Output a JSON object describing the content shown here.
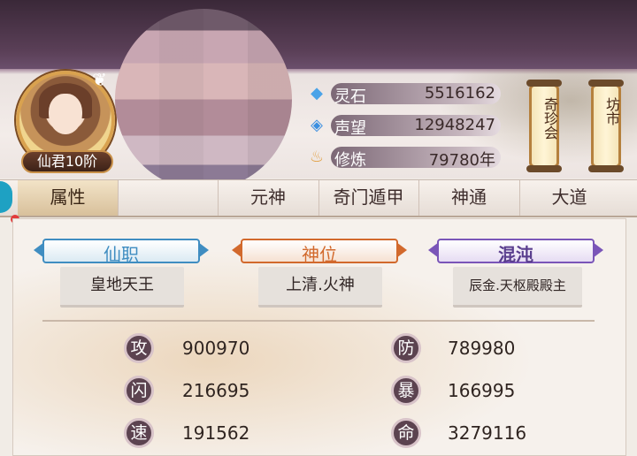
{
  "profile": {
    "rank_label": "仙君10阶"
  },
  "resources": [
    {
      "icon": "spirit-stone-icon",
      "label": "灵石",
      "value": "5516162",
      "icon_color": "#4aa3e8"
    },
    {
      "icon": "reputation-icon",
      "label": "声望",
      "value": "12948247",
      "icon_color": "#3b8fe0"
    },
    {
      "icon": "cultivation-icon",
      "label": "修炼",
      "value": "79780年",
      "icon_color": "#e2a34a"
    }
  ],
  "scroll_buttons": [
    {
      "label": "奇珍会"
    },
    {
      "label": "坊市"
    }
  ],
  "tabs": [
    {
      "label": "属性",
      "active": true
    },
    {
      "label": "",
      "active": false
    },
    {
      "label": "元神",
      "active": false
    },
    {
      "label": "奇门遁甲",
      "active": false
    },
    {
      "label": "神通",
      "active": false
    },
    {
      "label": "大道",
      "active": false
    }
  ],
  "titles": [
    {
      "heading": "仙职",
      "value": "皇地天王",
      "color": "#3f8dc1"
    },
    {
      "heading": "神位",
      "value": "上清.火神",
      "color": "#d2692c"
    },
    {
      "heading": "混沌",
      "value": "辰金.天枢殿殿主",
      "color": "#7a55b8"
    }
  ],
  "stats": [
    {
      "glyph": "攻",
      "value": "900970"
    },
    {
      "glyph": "防",
      "value": "789980"
    },
    {
      "glyph": "闪",
      "value": "216695"
    },
    {
      "glyph": "暴",
      "value": "166995"
    },
    {
      "glyph": "速",
      "value": "191562"
    },
    {
      "glyph": "命",
      "value": "3279116"
    }
  ],
  "colors": {
    "accent_tab": "#d8c09b",
    "edge_button": "#1ea1c3",
    "notify": "#e23b3b"
  }
}
